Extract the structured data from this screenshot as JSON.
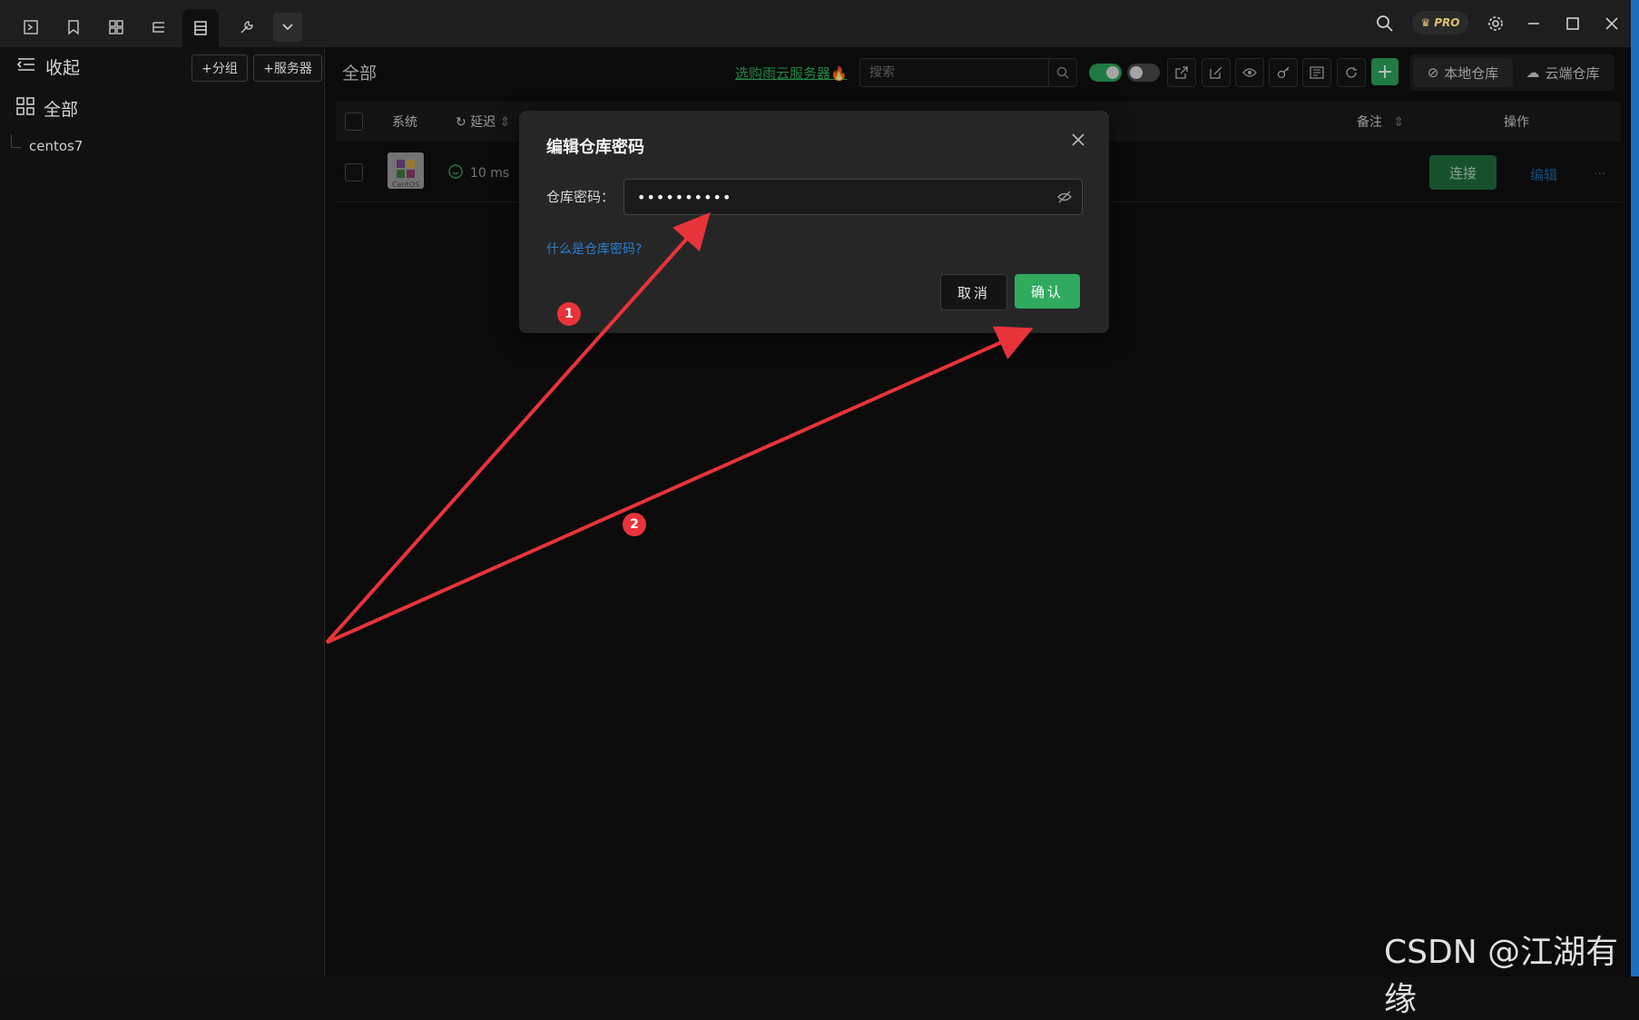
{
  "topbar": {
    "tools": [
      "terminal-icon",
      "bookmark-icon",
      "layout-icon",
      "tree-icon",
      "list-icon",
      "wrench-icon"
    ],
    "pro_label": "PRO"
  },
  "sidebar": {
    "collapse_label": "收起",
    "add_group_label": "+分组",
    "add_server_label": "+服务器",
    "all_label": "全部",
    "tree_item": "centos7"
  },
  "main": {
    "title": "全部",
    "promo_text": "选购雨云服务器🔥",
    "search_placeholder": "搜索",
    "seg_local": "本地仓库",
    "seg_cloud": "云端仓库",
    "plus": "+"
  },
  "table": {
    "headers": {
      "system": "系统",
      "latency": "延迟",
      "note": "备注",
      "actions": "操作"
    },
    "rows": [
      {
        "os_logo_text": "CentOS",
        "latency": "10 ms",
        "connect": "连接",
        "edit": "编辑",
        "more": "..."
      }
    ]
  },
  "dialog": {
    "title": "编辑仓库密码",
    "field_label": "仓库密码：",
    "password_value": "••••••••••",
    "help_link": "什么是仓库密码?",
    "cancel": "取消",
    "confirm": "确认"
  },
  "annotations": {
    "badge1": "1",
    "badge2": "2",
    "arrow_color": "#e8333a"
  },
  "watermark": "CSDN @江湖有缘",
  "colors": {
    "accent_green": "#2faa5e",
    "link_blue": "#2a7fd0",
    "bg_dark": "#0f0f0f"
  }
}
